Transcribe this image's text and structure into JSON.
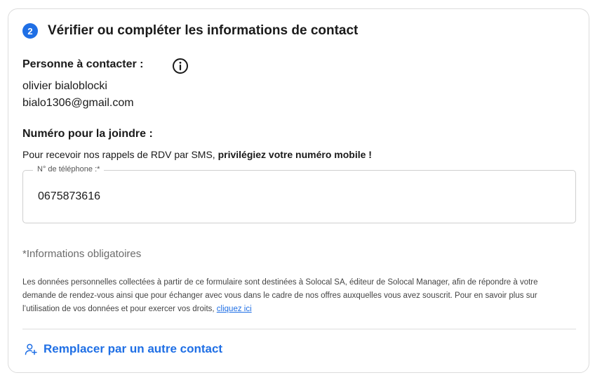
{
  "step": {
    "number": "2",
    "title": "Vérifier ou compléter les informations de contact"
  },
  "contact_person": {
    "label": "Personne à contacter :",
    "name": "olivier bialoblocki",
    "email": "bialo1306@gmail.com"
  },
  "phone_section": {
    "label": "Numéro pour la joindre :",
    "sms_text": "Pour recevoir nos rappels de RDV par SMS, ",
    "sms_emphasis": "privilégiez votre numéro mobile !",
    "field_label": "N° de téléphone :*",
    "field_value": "0675873616"
  },
  "mandatory_note": "*Informations obligatoires",
  "legal": {
    "text": "Les données personnelles collectées à partir de ce formulaire sont destinées à Solocal SA, éditeur de Solocal Manager, afin de répondre à votre demande de rendez-vous ainsi que pour échanger avec vous dans le cadre de nos offres auxquelles vous avez souscrit. Pour en savoir plus sur l’utilisation de vos données et pour exercer vos droits, ",
    "link_label": "cliquez ici"
  },
  "replace_button": {
    "label": "Remplacer par un autre contact",
    "icon": "user-plus-icon"
  },
  "colors": {
    "accent": "#1f6fe5",
    "border": "#dcdcdc",
    "muted": "#6b6b6b"
  }
}
